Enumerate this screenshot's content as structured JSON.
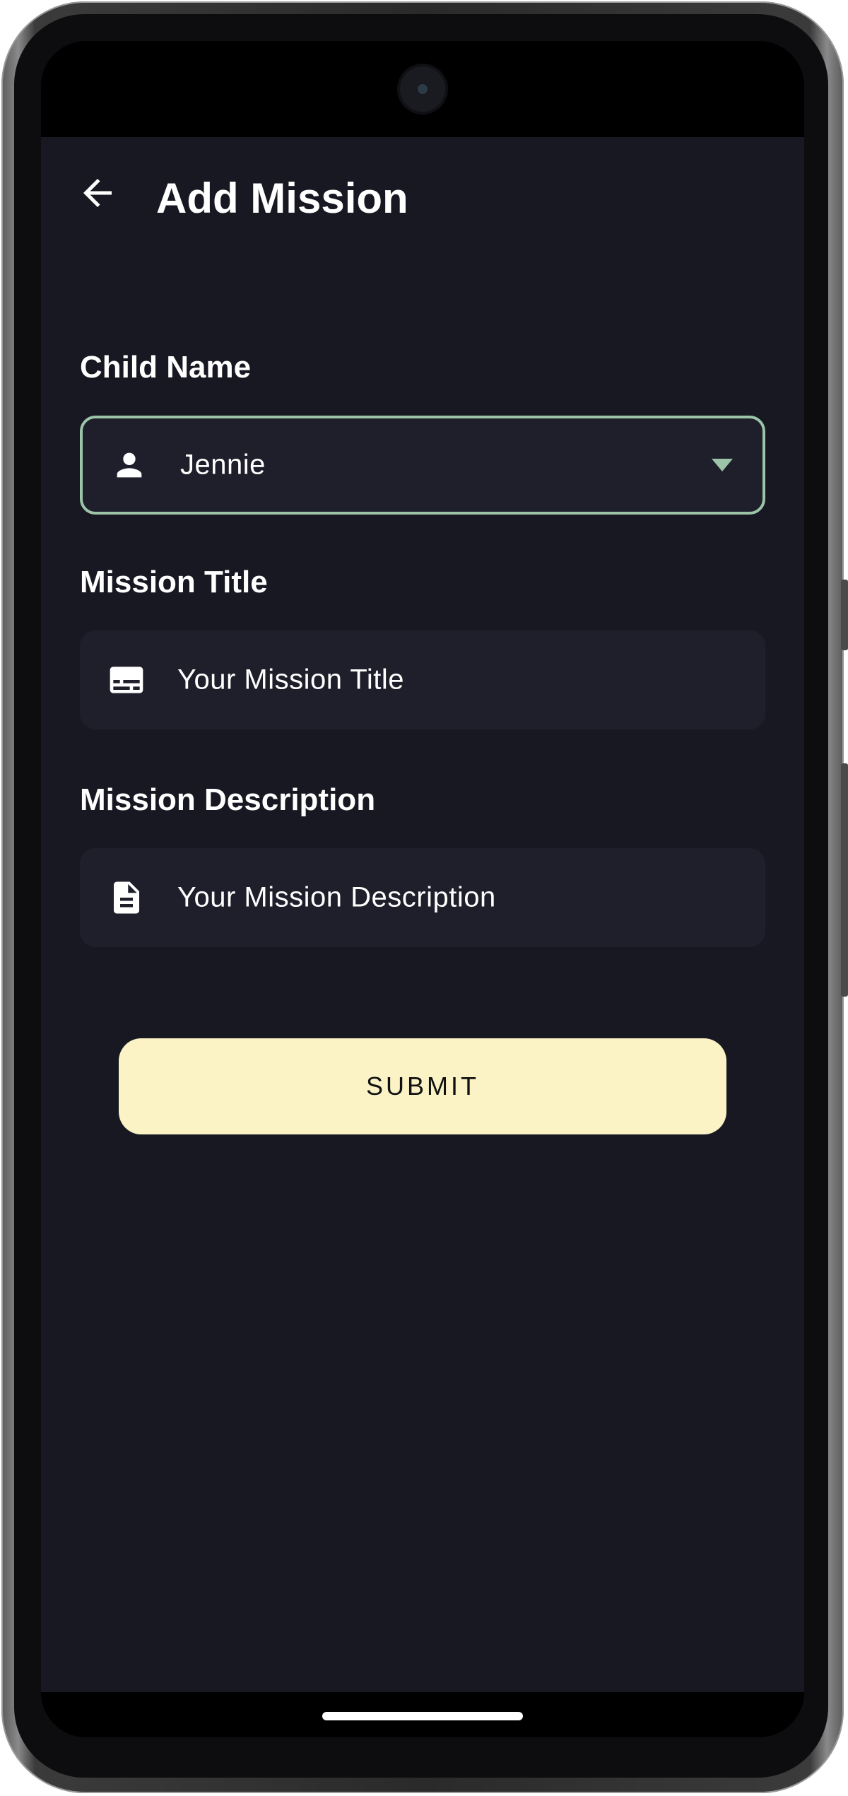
{
  "header": {
    "title": "Add Mission",
    "back_icon": "arrow-left-icon"
  },
  "form": {
    "child_name": {
      "label": "Child Name",
      "value": "Jennie",
      "icon": "person-icon",
      "border_color": "#9cc4a8"
    },
    "mission_title": {
      "label": "Mission Title",
      "placeholder": "Your Mission Title",
      "icon": "subtitles-icon"
    },
    "mission_description": {
      "label": "Mission Description",
      "placeholder": "Your Mission Description",
      "icon": "document-icon"
    },
    "submit_label": "SUBMIT"
  },
  "colors": {
    "background": "#181822",
    "field_background": "#1f1f2b",
    "accent": "#9cc4a8",
    "button": "#fbf3c6"
  }
}
